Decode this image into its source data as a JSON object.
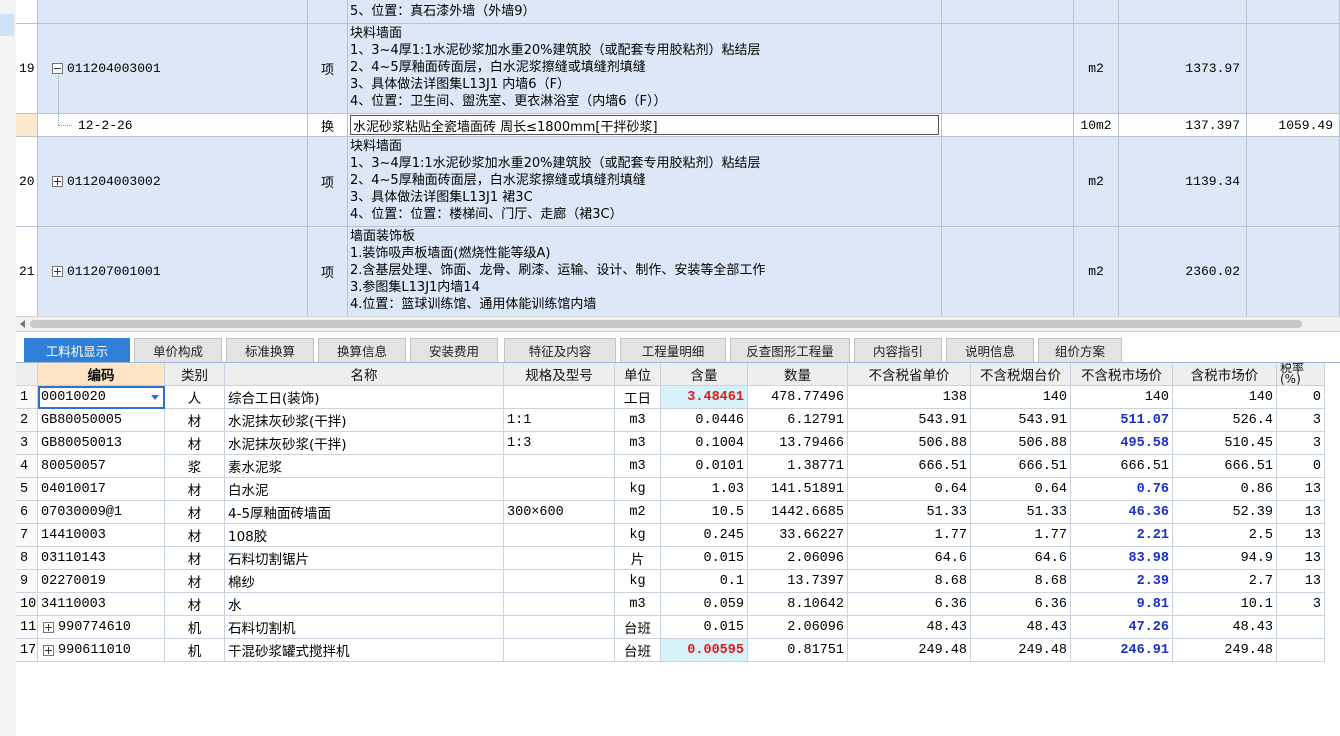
{
  "upper_grid": {
    "rows": [
      {
        "type": "item-partial",
        "num": "",
        "code": "",
        "unit_label": "",
        "desc": [
          "5、位置：真石漆外墙（外墙9）"
        ],
        "unit": "",
        "qty": "",
        "price": ""
      },
      {
        "type": "item",
        "num": "19",
        "code": "011204003001",
        "expander": "minus",
        "kind": "项",
        "desc": [
          "块料墙面",
          "1、3~4厚1:1水泥砂浆加水重20%建筑胶（或配套专用胶粘剂）粘结层",
          "2、4~5厚釉面砖面层，白水泥浆擦缝或填缝剂填缝",
          "3、具体做法详图集L13J1 内墙6（F）",
          "4、位置：卫生间、盥洗室、更衣淋浴室（内墙6（F））"
        ],
        "unit": "m2",
        "qty": "1373.97",
        "price": ""
      },
      {
        "type": "sub",
        "num": "",
        "code": "12-2-26",
        "kind": "换",
        "desc": [
          "水泥砂浆粘贴全瓷墙面砖 周长≤1800mm[干拌砂浆]"
        ],
        "unit": "10m2",
        "qty": "137.397",
        "price": "1059.49"
      },
      {
        "type": "item",
        "num": "20",
        "code": "011204003002",
        "expander": "plus",
        "kind": "项",
        "desc": [
          "块料墙面",
          "1、3~4厚1:1水泥砂浆加水重20%建筑胶（或配套专用胶粘剂）粘结层",
          "2、4~5厚釉面砖面层，白水泥浆擦缝或填缝剂填缝",
          "3、具体做法详图集L13J1 裙3C",
          "4、位置：位置：楼梯间、门厅、走廊（裙3C）"
        ],
        "unit": "m2",
        "qty": "1139.34",
        "price": ""
      },
      {
        "type": "item",
        "num": "21",
        "code": "011207001001",
        "expander": "plus",
        "kind": "项",
        "desc": [
          "墙面装饰板",
          "1.装饰吸声板墙面(燃烧性能等级A)",
          "2.含基层处理、饰面、龙骨、刷漆、运输、设计、制作、安装等全部工作",
          "3.参图集L13J1内墙14",
          "4.位置：篮球训练馆、通用体能训练馆内墙"
        ],
        "unit": "m2",
        "qty": "2360.02",
        "price": ""
      }
    ]
  },
  "tabs": [
    "工料机显示",
    "单价构成",
    "标准换算",
    "换算信息",
    "安装费用",
    "特征及内容",
    "工程量明细",
    "反查图形工程量",
    "内容指引",
    "说明信息",
    "组价方案"
  ],
  "active_tab": 0,
  "lower_grid": {
    "headers": [
      "编码",
      "类别",
      "名称",
      "规格及型号",
      "单位",
      "含量",
      "数量",
      "不含税省单价",
      "不含税烟台价",
      "不含税市场价",
      "含税市场价",
      "税率(%)"
    ],
    "rows": [
      {
        "idx": "1",
        "code": "00010020",
        "cat": "人",
        "name": "综合工日(装饰)",
        "spec": "",
        "unit": "工日",
        "content": "3.48461",
        "qty": "478.77496",
        "p1": "138",
        "p2": "140",
        "p3": "140",
        "p4": "140",
        "tax": "0",
        "content_style": "red",
        "p3_style": "",
        "selected": true
      },
      {
        "idx": "2",
        "code": "GB80050005",
        "cat": "材",
        "name": "水泥抹灰砂浆(干拌)",
        "spec": "1:1",
        "unit": "m3",
        "content": "0.0446",
        "qty": "6.12791",
        "p1": "543.91",
        "p2": "543.91",
        "p3": "511.07",
        "p4": "526.4",
        "tax": "3",
        "p3_style": "blue"
      },
      {
        "idx": "3",
        "code": "GB80050013",
        "cat": "材",
        "name": "水泥抹灰砂浆(干拌)",
        "spec": "1:3",
        "unit": "m3",
        "content": "0.1004",
        "qty": "13.79466",
        "p1": "506.88",
        "p2": "506.88",
        "p3": "495.58",
        "p4": "510.45",
        "tax": "3",
        "p3_style": "blue"
      },
      {
        "idx": "4",
        "code": "80050057",
        "cat": "浆",
        "name": "素水泥浆",
        "spec": "",
        "unit": "m3",
        "content": "0.0101",
        "qty": "1.38771",
        "p1": "666.51",
        "p2": "666.51",
        "p3": "666.51",
        "p4": "666.51",
        "tax": "0",
        "p3_style": ""
      },
      {
        "idx": "5",
        "code": "04010017",
        "cat": "材",
        "name": "白水泥",
        "spec": "",
        "unit": "kg",
        "content": "1.03",
        "qty": "141.51891",
        "p1": "0.64",
        "p2": "0.64",
        "p3": "0.76",
        "p4": "0.86",
        "tax": "13",
        "p3_style": "blue"
      },
      {
        "idx": "6",
        "code": "07030009@1",
        "cat": "材",
        "name": "4-5厚釉面砖墙面",
        "spec": "300×600",
        "unit": "m2",
        "content": "10.5",
        "qty": "1442.6685",
        "p1": "51.33",
        "p2": "51.33",
        "p3": "46.36",
        "p4": "52.39",
        "tax": "13",
        "p3_style": "blue"
      },
      {
        "idx": "7",
        "code": "14410003",
        "cat": "材",
        "name": "108胶",
        "spec": "",
        "unit": "kg",
        "content": "0.245",
        "qty": "33.66227",
        "p1": "1.77",
        "p2": "1.77",
        "p3": "2.21",
        "p4": "2.5",
        "tax": "13",
        "p3_style": "blue"
      },
      {
        "idx": "8",
        "code": "03110143",
        "cat": "材",
        "name": "石料切割锯片",
        "spec": "",
        "unit": "片",
        "content": "0.015",
        "qty": "2.06096",
        "p1": "64.6",
        "p2": "64.6",
        "p3": "83.98",
        "p4": "94.9",
        "tax": "13",
        "p3_style": "blue"
      },
      {
        "idx": "9",
        "code": "02270019",
        "cat": "材",
        "name": "棉纱",
        "spec": "",
        "unit": "kg",
        "content": "0.1",
        "qty": "13.7397",
        "p1": "8.68",
        "p2": "8.68",
        "p3": "2.39",
        "p4": "2.7",
        "tax": "13",
        "p3_style": "blue"
      },
      {
        "idx": "10",
        "code": "34110003",
        "cat": "材",
        "name": "水",
        "spec": "",
        "unit": "m3",
        "content": "0.059",
        "qty": "8.10642",
        "p1": "6.36",
        "p2": "6.36",
        "p3": "9.81",
        "p4": "10.1",
        "tax": "3",
        "p3_style": "blue"
      },
      {
        "idx": "11",
        "code": "990774610",
        "cat": "机",
        "name": "石料切割机",
        "spec": "",
        "unit": "台班",
        "content": "0.015",
        "qty": "2.06096",
        "p1": "48.43",
        "p2": "48.43",
        "p3": "47.26",
        "p4": "48.43",
        "tax": "",
        "p3_style": "blue",
        "expander": true
      },
      {
        "idx": "17",
        "code": "990611010",
        "cat": "机",
        "name": "干混砂浆罐式搅拌机",
        "spec": "",
        "unit": "台班",
        "content": "0.00595",
        "qty": "0.81751",
        "p1": "249.48",
        "p2": "249.48",
        "p3": "246.91",
        "p4": "249.48",
        "tax": "",
        "content_style": "red",
        "p3_style": "blue",
        "expander": true
      }
    ]
  }
}
